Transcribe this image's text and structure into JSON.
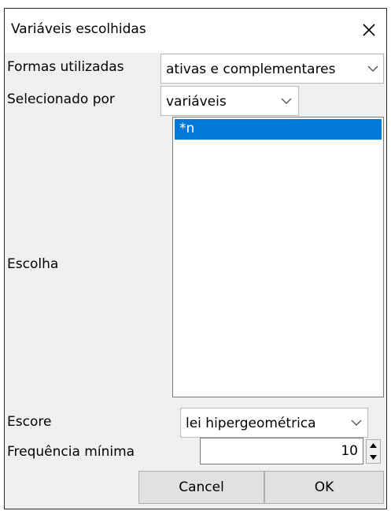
{
  "dialog": {
    "title": "Variáveis escolhidas",
    "close_icon": "close-icon"
  },
  "form": {
    "formas_label": "Formas utilizadas",
    "formas_value": "ativas e complementares",
    "selecionado_label": "Selecionado por",
    "selecionado_value": "variáveis",
    "escolha_label": "Escolha",
    "escolha_items": [
      "*n"
    ],
    "escore_label": "Escore",
    "escore_value": "lei hipergeométrica",
    "frequencia_label": "Frequência mínima",
    "frequencia_value": "10"
  },
  "buttons": {
    "cancel": "Cancel",
    "ok": "OK"
  },
  "colors": {
    "selection": "#0078d7",
    "dialog_bg": "#f0f0f0"
  }
}
